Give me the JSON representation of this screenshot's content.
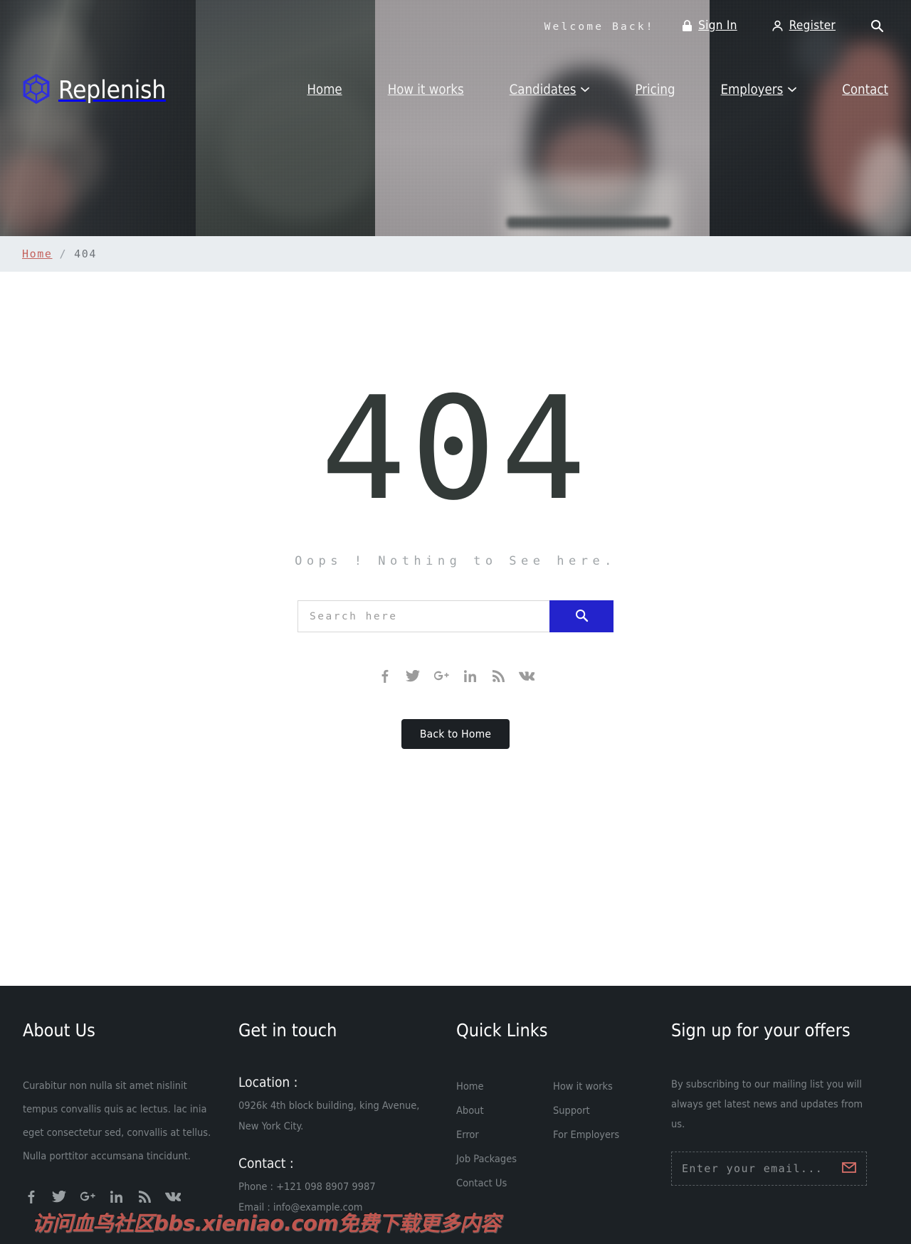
{
  "header": {
    "logo_text": "Replenish",
    "logo_icon": "hexagon-cube-logo-icon",
    "logo_color": "#2d2de0",
    "welcome_text": "Welcome Back!",
    "sign_in_label": "Sign In",
    "register_label": "Register",
    "search_icon": "search-icon",
    "nav": [
      {
        "label": "Home",
        "has_dropdown": false
      },
      {
        "label": "How it works",
        "has_dropdown": false
      },
      {
        "label": "Candidates",
        "has_dropdown": true
      },
      {
        "label": "Pricing",
        "has_dropdown": false
      },
      {
        "label": "Employers",
        "has_dropdown": true
      },
      {
        "label": "Contact",
        "has_dropdown": false
      }
    ],
    "caret": "⌄"
  },
  "breadcrumb": {
    "home": "Home",
    "separator": "/",
    "current": "404"
  },
  "main": {
    "code": "404",
    "message": "Oops ! Nothing to See here.",
    "search_placeholder": "Search here",
    "search_value": "",
    "search_button_icon": "search-icon",
    "back_button": "Back to Home",
    "accent_color": "#2323cc",
    "socials": [
      "facebook-icon",
      "twitter-icon",
      "google-plus-icon",
      "linkedin-icon",
      "rss-icon",
      "vk-icon"
    ]
  },
  "footer": {
    "about": {
      "title": "About Us",
      "text": "Curabitur non nulla sit amet nislinit tempus convallis quis ac lectus. lac inia eget consectetur sed, convallis at tellus. Nulla porttitor accumsana tincidunt.",
      "socials": [
        "facebook-icon",
        "twitter-icon",
        "google-plus-icon",
        "linkedin-icon",
        "rss-icon",
        "vk-icon"
      ]
    },
    "touch": {
      "title": "Get in touch",
      "location_label": "Location :",
      "address_line1": "0926k 4th block building, king Avenue,",
      "address_line2": "New York City.",
      "contact_label": "Contact :",
      "phone": "Phone : +121 098 8907 9987",
      "email": "Email : info@example.com"
    },
    "quick_links": {
      "title": "Quick Links",
      "col1": [
        "Home",
        "About",
        "Error",
        "Job Packages",
        "Contact Us"
      ],
      "col2": [
        "How it works",
        "Support",
        "For Employers"
      ]
    },
    "newsletter": {
      "title": "Sign up for your offers",
      "description": "By subscribing to our mailing list you will always get latest news and updates from us.",
      "placeholder": "Enter your email...",
      "value": "",
      "submit_icon": "envelope-icon",
      "icon_color": "#d9706a"
    }
  },
  "watermark": {
    "text": "访问血鸟社区bbs.xieniao.com免费下载更多内容"
  }
}
